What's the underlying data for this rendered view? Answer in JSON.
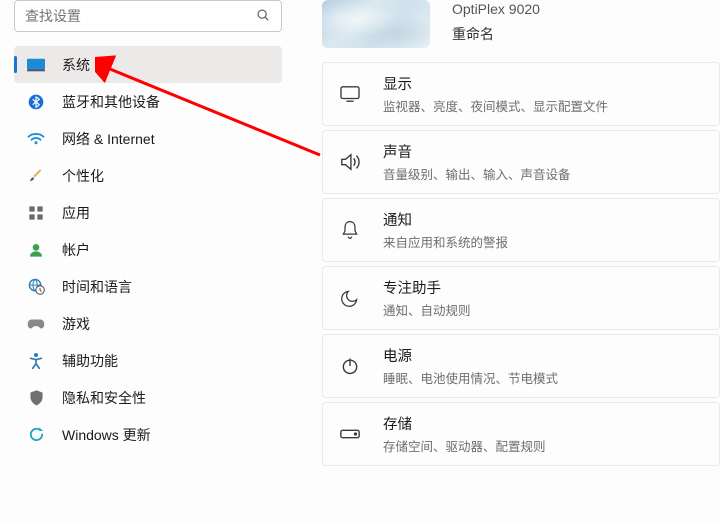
{
  "search": {
    "placeholder": "查找设置"
  },
  "pc": {
    "model": "OptiPlex 9020",
    "rename": "重命名"
  },
  "sidebar": {
    "items": [
      {
        "label": "系统"
      },
      {
        "label": "蓝牙和其他设备"
      },
      {
        "label": "网络 & Internet"
      },
      {
        "label": "个性化"
      },
      {
        "label": "应用"
      },
      {
        "label": "帐户"
      },
      {
        "label": "时间和语言"
      },
      {
        "label": "游戏"
      },
      {
        "label": "辅助功能"
      },
      {
        "label": "隐私和安全性"
      },
      {
        "label": "Windows 更新"
      }
    ]
  },
  "cards": [
    {
      "title": "显示",
      "sub": "监视器、亮度、夜间模式、显示配置文件"
    },
    {
      "title": "声音",
      "sub": "音量级别、输出、输入、声音设备"
    },
    {
      "title": "通知",
      "sub": "来自应用和系统的警报"
    },
    {
      "title": "专注助手",
      "sub": "通知、自动规则"
    },
    {
      "title": "电源",
      "sub": "睡眠、电池使用情况、节电模式"
    },
    {
      "title": "存储",
      "sub": "存储空间、驱动器、配置规则"
    }
  ]
}
